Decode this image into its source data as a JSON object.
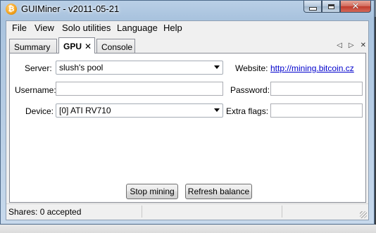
{
  "window": {
    "title": "GUIMiner - v2011-05-21",
    "icon": "bitcoin-icon",
    "icon_glyph": "₿"
  },
  "menu": [
    "File",
    "View",
    "Solo utilities",
    "Language",
    "Help"
  ],
  "tabs": [
    {
      "label": "Summary",
      "active": false
    },
    {
      "label": "GPU",
      "active": true,
      "close_glyph": "✕"
    },
    {
      "label": "Console",
      "active": false
    }
  ],
  "tab_nav": {
    "prev": "◁",
    "next": "▷",
    "close": "✕"
  },
  "form": {
    "server_label": "Server:",
    "server_value": "slush's pool",
    "website_label": "Website:",
    "website_link": "http://mining.bitcoin.cz",
    "username_label": "Username:",
    "username_value": "",
    "password_label": "Password:",
    "password_value": "",
    "device_label": "Device:",
    "device_value": "[0] ATI RV710",
    "extra_flags_label": "Extra flags:",
    "extra_flags_value": ""
  },
  "buttons": {
    "stop_mining": "Stop mining",
    "refresh_balance": "Refresh balance"
  },
  "status": {
    "text": "Shares: 0 accepted"
  },
  "caption_buttons": {
    "close_glyph": "✕"
  }
}
